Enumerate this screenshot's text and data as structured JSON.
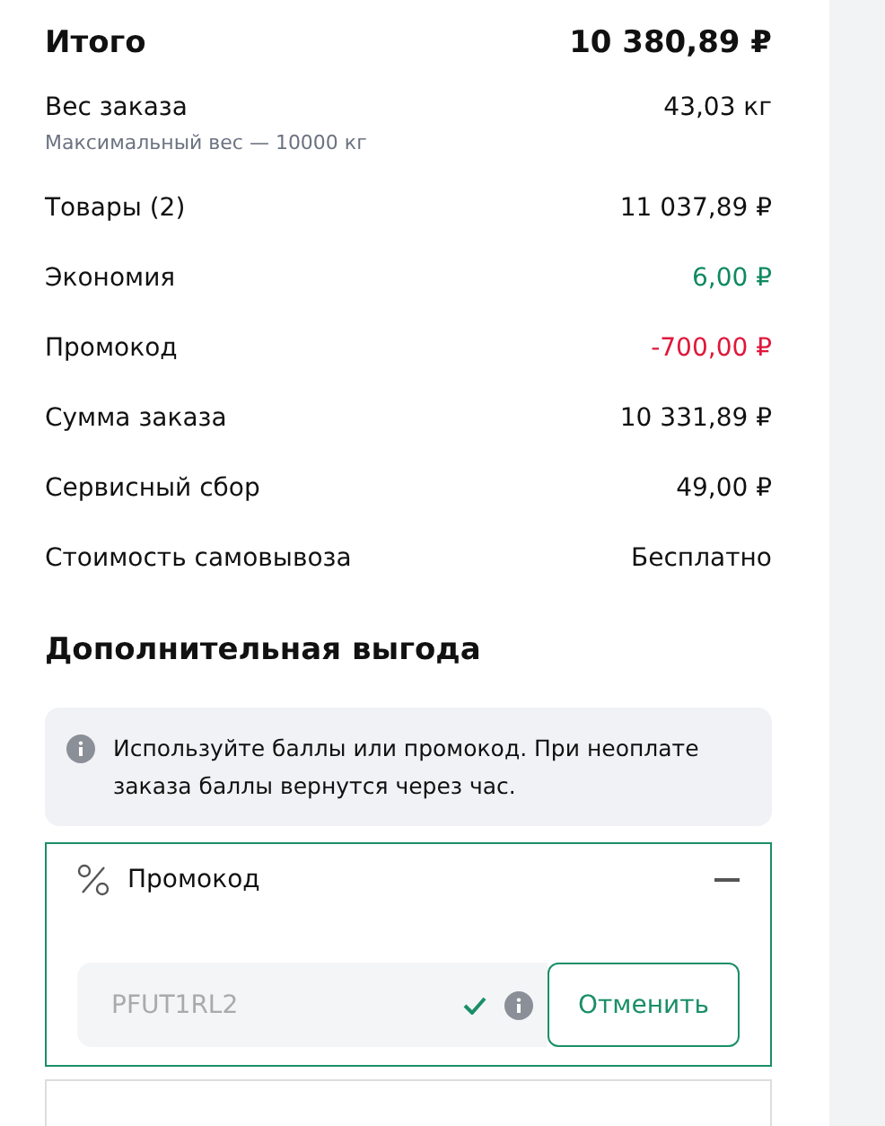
{
  "total": {
    "label": "Итого",
    "value": "10 380,89 ₽"
  },
  "rows": [
    {
      "label": "Вес заказа",
      "note": "Максимальный вес — 10000 кг",
      "value": "43,03 кг",
      "kind": "default"
    },
    {
      "label": "Товары (2)",
      "value": "11 037,89 ₽",
      "kind": "default"
    },
    {
      "label": "Экономия",
      "value": "6,00 ₽",
      "kind": "positive"
    },
    {
      "label": "Промокод",
      "value": "-700,00 ₽",
      "kind": "negative"
    },
    {
      "label": "Сумма заказа",
      "value": "10 331,89 ₽",
      "kind": "default"
    },
    {
      "label": "Сервисный сбор",
      "value": "49,00 ₽",
      "kind": "default"
    },
    {
      "label": "Стоимость самовывоза",
      "value": "Бесплатно",
      "kind": "default"
    }
  ],
  "section_title": "Дополнительная выгода",
  "info": "Используйте баллы или промокод. При неоплате заказа баллы вернутся через час.",
  "promo": {
    "title": "Промокод",
    "expanded": true,
    "code": "PFUT1RL2",
    "valid": true,
    "button": "Отменить"
  }
}
